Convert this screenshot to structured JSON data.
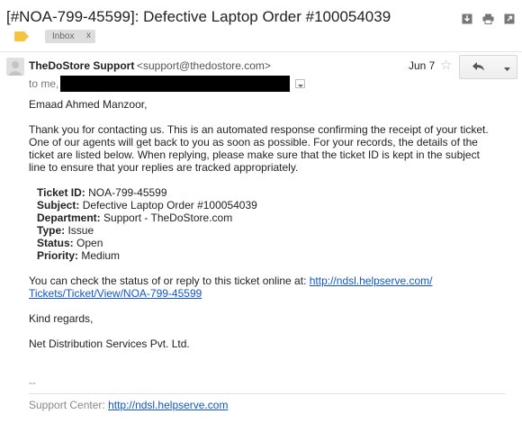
{
  "email": {
    "subject": "[#NOA-799-45599]: Defective Laptop Order #100054039",
    "label": "Inbox",
    "label_close": "x",
    "sender_name": "TheDoStore Support",
    "sender_email": "<support@thedostore.com>",
    "date": "Jun 7",
    "recipient_prefix": "to me,",
    "greeting": "Emaad Ahmed Manzoor,",
    "paragraph_lines": [
      "Thank you for contacting us. This is an automated response confirming the receipt of your ticket.",
      "One of our agents will get back to you as soon as possible. For your records, the details of the",
      "ticket are listed below. When replying, please make sure that the ticket ID is kept in the subject",
      "line to ensure that your replies are tracked appropriately."
    ],
    "ticket_fields": [
      {
        "label": "Ticket ID:",
        "value": "NOA-799-45599"
      },
      {
        "label": "Subject:",
        "value": "Defective Laptop Order #100054039"
      },
      {
        "label": "Department:",
        "value": "Support - TheDoStore.com"
      },
      {
        "label": "Type:",
        "value": "Issue"
      },
      {
        "label": "Status:",
        "value": "Open"
      },
      {
        "label": "Priority:",
        "value": "Medium"
      }
    ],
    "status_text": "You can check the status of or reply to this ticket online at:",
    "status_link_line1": "http://ndsl.helpserve.com/",
    "status_link_line2": "Tickets/Ticket/View/NOA-799-45599",
    "closing": "Kind regards,",
    "company": "Net Distribution Services Pvt. Ltd.",
    "sig_dashes": "--",
    "support_center_label": "Support Center:",
    "support_center_link": "http://ndsl.helpserve.com"
  },
  "icons": {
    "download": "download-icon",
    "print": "print-icon",
    "new_window": "new-window-icon",
    "tag": "label-tag-icon",
    "avatar": "avatar",
    "star": "star-icon",
    "reply": "reply-icon",
    "more": "chevron-down-icon"
  },
  "colors": {
    "link": "#1155cc",
    "tag": "#f5c242",
    "label_bg": "#dddddd"
  }
}
